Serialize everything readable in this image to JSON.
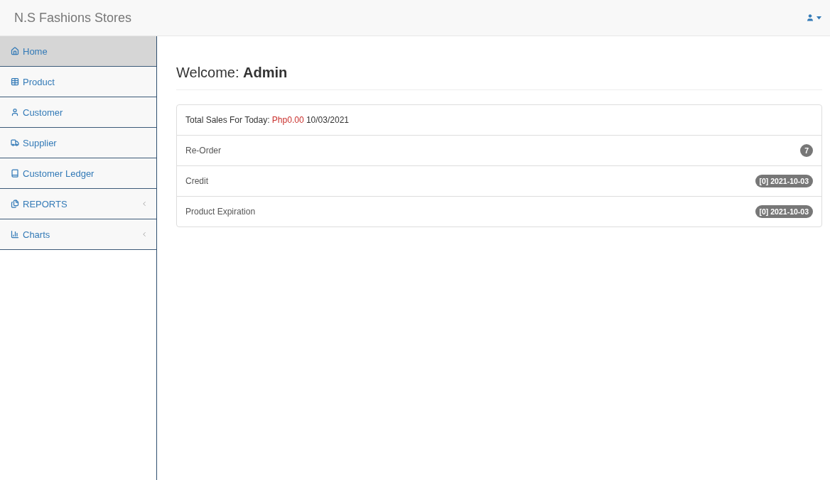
{
  "navbar": {
    "brand": "N.S Fashions Stores"
  },
  "sidebar": {
    "items": [
      {
        "label": "Home",
        "selected": true
      },
      {
        "label": "Product",
        "selected": false
      },
      {
        "label": "Customer",
        "selected": false
      },
      {
        "label": "Supplier",
        "selected": false
      },
      {
        "label": "Customer Ledger",
        "selected": false
      },
      {
        "label": "REPORTS",
        "selected": false,
        "expanded": false
      },
      {
        "label": "Charts",
        "selected": false,
        "expanded": false
      }
    ]
  },
  "page": {
    "heading": "Welcome: **Admin**"
  },
  "summary": {
    "total_sales": {
      "label": "Total Sales For Today:",
      "amount": "Php0.00",
      "date": "10/03/2021"
    },
    "rows": [
      {
        "label": "Re-Order",
        "badge": "7"
      },
      {
        "label": "Credit",
        "badge": "[0] 2021-10-03"
      },
      {
        "label": "Product Expiration",
        "badge": "[0] 2021-10-03"
      }
    ]
  }
}
